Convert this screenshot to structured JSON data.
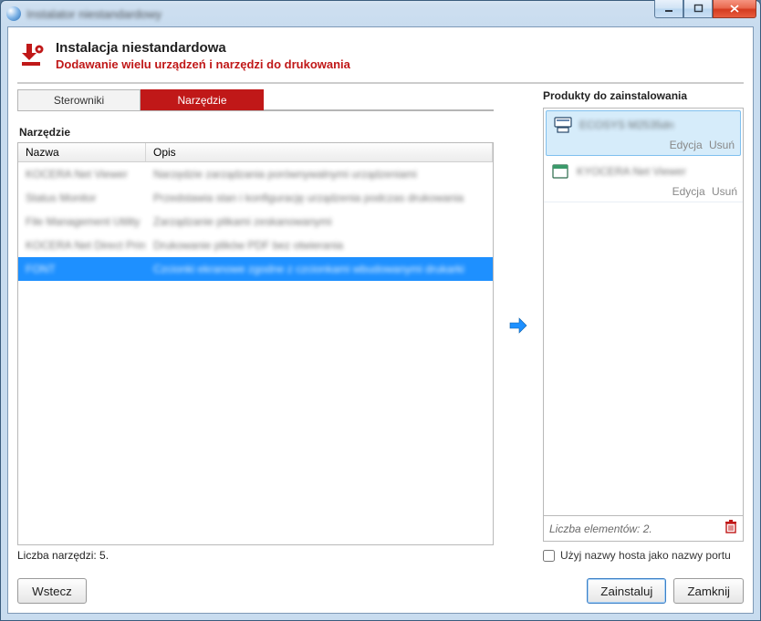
{
  "window": {
    "title": "Instalator niestandardowy"
  },
  "header": {
    "title": "Instalacja niestandardowa",
    "subtitle": "Dodawanie wielu urządzeń i narzędzi do drukowania"
  },
  "tabs": {
    "drivers": "Sterowniki",
    "tools": "Narzędzie",
    "active": "tools"
  },
  "table": {
    "section": "Narzędzie",
    "columns": {
      "name": "Nazwa",
      "desc": "Opis"
    },
    "rows": [
      {
        "name": "KOCERA Net Viewer",
        "desc": "Narzędzie zarządzania porównywalnymi urządzeniami"
      },
      {
        "name": "Status Monitor",
        "desc": "Przedstawia stan i konfigurację urządzenia podczas drukowania"
      },
      {
        "name": "File Management Utility",
        "desc": "Zarządzanie plikami zeskanowanymi"
      },
      {
        "name": "KOCERA Net Direct Print",
        "desc": "Drukowanie plików PDF bez otwierania"
      },
      {
        "name": "FONT",
        "desc": "Czcionki ekranowe zgodne z czcionkami wbudowanymi drukarki"
      }
    ],
    "selected": 4,
    "count": "Liczba narzędzi: 5."
  },
  "products": {
    "title": "Produkty do zainstalowania",
    "items": [
      {
        "name": "ECOSYS M2535dn",
        "icon": "printer",
        "actions": {
          "edit": "Edycja",
          "remove": "Usuń"
        },
        "selected": true
      },
      {
        "name": "KYOCERA Net Viewer",
        "icon": "app",
        "actions": {
          "edit": "Edycja",
          "remove": "Usuń"
        },
        "selected": false
      }
    ],
    "summary": "Liczba elementów: 2.",
    "checkbox": "Użyj nazwy hosta jako nazwy portu"
  },
  "footer": {
    "back": "Wstecz",
    "install": "Zainstaluj",
    "close": "Zamknij"
  }
}
